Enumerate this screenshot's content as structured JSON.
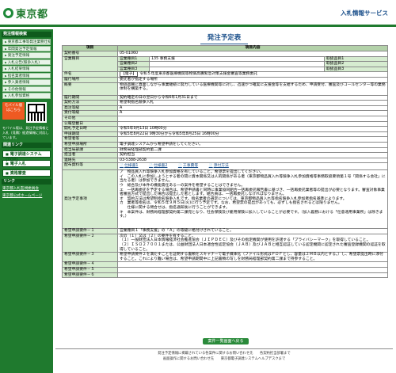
{
  "header": {
    "logo_text": "東京都",
    "system_title": "入札情報サービス"
  },
  "sidebar": {
    "heading1": "発注情報検索",
    "items": [
      "東京都工事等発注業務仕様書",
      "年間発注予定情報",
      "発注予定情報",
      "入札公告(競争入札)",
      "入札結果情報",
      "指名業者情報",
      "参入業者情報",
      "その他情報",
      "入札参加資格"
    ],
    "mobile_badge": "モバイル版 はこちら",
    "mobile_note": "モバイル版は、発注予定情報と入札（見積）経過情報に対応しています。",
    "heading2": "関連リンク",
    "buttons": [
      "電子調達システム(TOP)",
      "電子入札",
      "資格審査"
    ],
    "heading3": "リンク",
    "links": [
      "東京都入札監視委員会",
      "東京都公式ホームページ"
    ]
  },
  "main": {
    "page_title": "発注予定表",
    "table_head": [
      "項目",
      "項目内容"
    ],
    "rows": {
      "contract_no": {
        "label": "契約番号",
        "value": "05-01060"
      },
      "type1": {
        "label": "営業種目",
        "sub": [
          "営業種目1",
          "営業種目2",
          "営業種目3"
        ],
        "vals": [
          "135 事務支援",
          "",
          ""
        ],
        "sub_labels": [
          "取扱品目1",
          "取扱品目2",
          "取扱品目3"
        ]
      },
      "name": {
        "label": "件名",
        "tag": "【電子】",
        "value": "令和５年度東京都医療機関等物価高騰緊急対策支援金審査等業務委託"
      },
      "method": {
        "label": "履行場所",
        "value": "委託者が指定する場所"
      },
      "summary": {
        "label": "概要",
        "value": "物価高騰に直面しながら事業継続に努力している医療機関等に対し、迅速かつ確実に支援金等を支給するため、申請受付、審査及びコールセンター等の業務体制を構築する。"
      },
      "period": {
        "label": "履行期間",
        "value": "契約確定の日の翌日から令和6年1月31日まで"
      },
      "contract_method": {
        "label": "契約方法",
        "value": "希望制指名競争入札"
      },
      "dept": {
        "label": "発注等級",
        "value": "A"
      },
      "receive": {
        "label": "受付等級",
        "value": "A"
      },
      "other": {
        "label": "その他",
        "value": ""
      },
      "announce": {
        "label": "公報登載日",
        "value": ""
      },
      "open_date": {
        "label": "開札予定日時",
        "value": "令和5年9月13日 10時00分"
      },
      "apply_period": {
        "label": "申請期間",
        "value": "令和5年8月22日 9時30分から令和5年8月25日 16時00分"
      },
      "apply_url": {
        "label": "希望者等",
        "value": ""
      },
      "apply_way": {
        "label": "希望申請場所",
        "value": "電子調達システムから希望申請をしてください。"
      },
      "dept_name": {
        "label": "担当局部課",
        "value": "財務局経理部契約第二課"
      },
      "person": {
        "label": "担当者",
        "value": "契約担当"
      },
      "tel": {
        "label": "連絡先",
        "value": "03-5388-2638"
      },
      "docs": {
        "label": "配布資料等",
        "files": [
          "仕様書1",
          "仕様書2",
          "工事費等",
          "添付方法"
        ]
      },
      "conditions": {
        "label": "発注予定事項",
        "value": "ア　物品買入れ等競争入札参加資格を有していること。希望票を提出してください。\nイ　この入札に参加しようとする者の間に資本関係又は人的関係がある者（東京都物品買入れ等競争入札参加資格等事務取扱要領第１号「関係する会社」に当たる者）は参加できません。\nウ　総合及び本件の機能責任ある一の案件を希望することはできません。\nエ　一括再委託を予定する場合は、希望申請書と同時に事業協同組合一括再委託報告書に基づき、一括再委託業者等の提出が必要となります。審査対象事業者審査方式で提出した場合は提出した者とします。組合員は、一括再委託しなければなりません。\nオ　契約方法は希望制指名競争入札です。指名業者の選定については、東京都物品買入れ等指名競争入札参加者指名基準によります。\nカ　業者等指名は、令和５年９月５日(火)に行う予定です。なお、希望票の提出があっても、必ずしも指名されるとは限りません。\n　　仕様に関する問合せは、指名通知後に行うことができます。\nキ　本案件は、財務局経理部契約第二課宛となり、社会保険及び雇用保険に加入していることが必要です。（加入義務における「任意適用事業所」は除きます。）"
      },
      "req1": {
        "label": "希望申請要件－１",
        "value": "営業種目１「事務支援」の「Ａ」の等級に格付けされていること。"
      },
      "req2": {
        "label": "希望申請要件－２",
        "value": "次の（１）又は（２）の要件を有すること。\n（１）一般財団法人日本情報経済社会推進協会（ＪＩＰＤＥＣ）及びその指定機関が使用を許諾する「プライバシーマーク」を取得していること。\n（２）ＩＳＯ２７００１または、公益財団法人日本適合性認定協会（ＪＡＢ）及びＪＡＢと相互認証している認定機関に認定された審査登録機関の認証を取得していること。"
      },
      "req3": {
        "label": "希望申請要件－３",
        "value": "希望申請要件２を満たすことを証明する書類をスキャナーで電子媒体化（ファイル形式はＰＤＦとし、容量は２ＭＢ以内とする。）し、希望票提出時に添付すること。これにより難い場合は、希望申請期間中に上記書類の写しを財務局経理部契約第二課まで持参すること。"
      },
      "req4": {
        "label": "希望申請要件－４",
        "value": ""
      },
      "req5": {
        "label": "希望申請要件－５",
        "value": ""
      },
      "req6": {
        "label": "希望申請要件－６",
        "value": ""
      }
    },
    "back_button": "案件一覧画面へ戻る"
  },
  "footer": {
    "line1": "発注予定情報に掲載されている各案件に関するお問い合わせ先　　各契約担当部署まで",
    "line2": "画面操作に関するお問い合わせ先　　東京都電子調達システムヘルプデスクまで"
  }
}
